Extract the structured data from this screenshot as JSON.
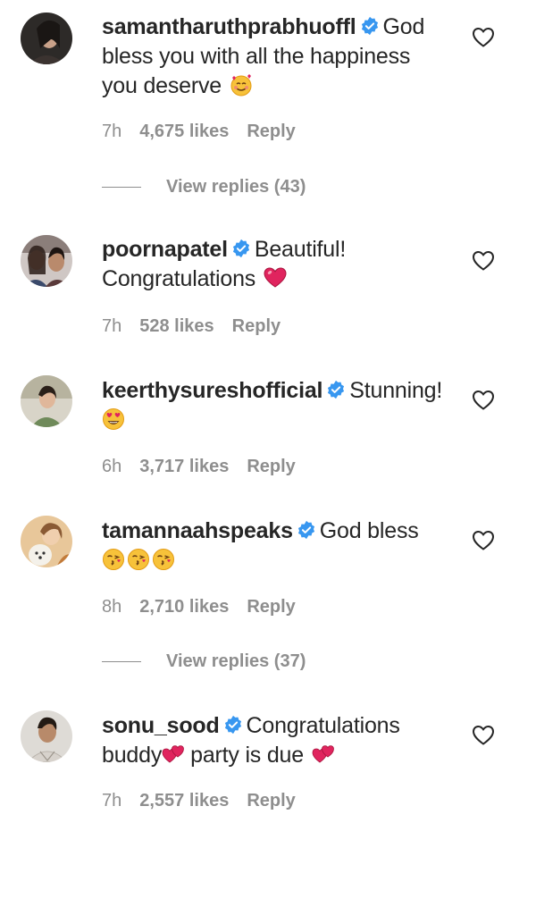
{
  "comments": [
    {
      "username": "samantharuthprabhuoffl",
      "text_lines": [
        "God",
        "bless you with all the happiness",
        "you deserve"
      ],
      "emoji": [
        "smiling-face-with-hearts"
      ],
      "time": "7h",
      "likes": "4,675 likes",
      "reply_label": "Reply",
      "view_replies": "View replies (43)"
    },
    {
      "username": "poornapatel",
      "text_lines": [
        "Beautiful!",
        "Congratulations"
      ],
      "emoji": [
        "red-heart"
      ],
      "time": "7h",
      "likes": "528 likes",
      "reply_label": "Reply"
    },
    {
      "username": "keerthysureshofficial",
      "text_lines": [
        "Stunning!"
      ],
      "emoji": [
        "heart-eyes"
      ],
      "time": "6h",
      "likes": "3,717 likes",
      "reply_label": "Reply"
    },
    {
      "username": "tamannaahspeaks",
      "text_lines": [
        "God bless"
      ],
      "emoji": [
        "kissing-heart",
        "kissing-heart",
        "kissing-heart"
      ],
      "time": "8h",
      "likes": "2,710 likes",
      "reply_label": "Reply",
      "view_replies": "View replies (37)"
    },
    {
      "username": "sonu_sood",
      "text_lines": [
        "Congratulations",
        "buddy",
        "party is due"
      ],
      "emoji": [
        "two-hearts",
        "two-hearts"
      ],
      "time": "7h",
      "likes": "2,557 likes",
      "reply_label": "Reply"
    }
  ],
  "colors": {
    "text": "#262626",
    "muted": "#8e8e8e",
    "verified": "#3897f0",
    "heart_red": "#e0245e"
  }
}
